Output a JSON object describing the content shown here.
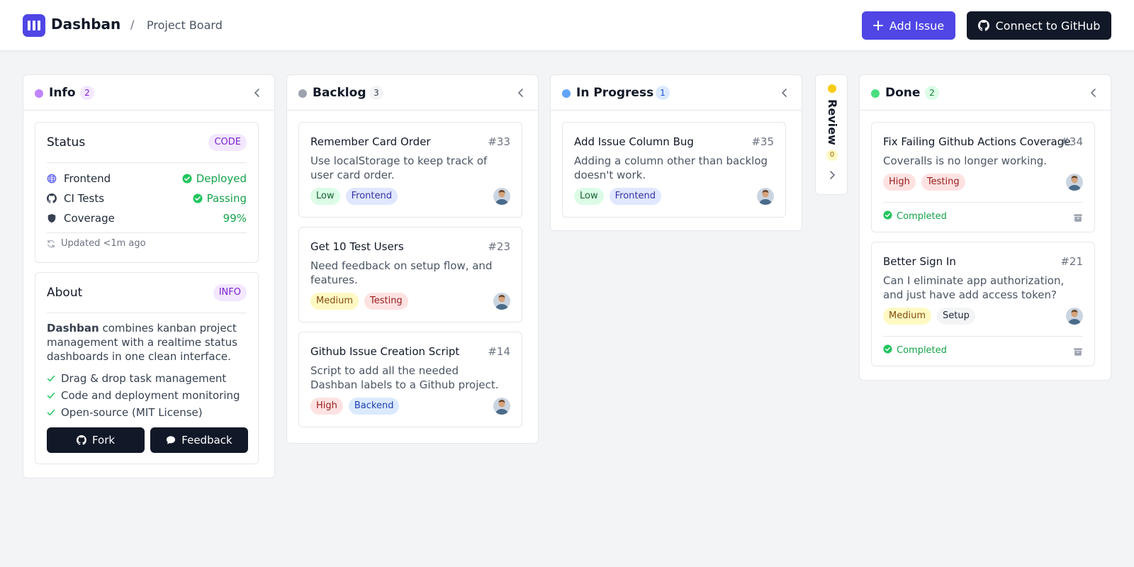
{
  "header": {
    "brand": "Dashban",
    "separator": "/",
    "breadcrumb": "Project Board",
    "add_issue_label": "Add Issue",
    "connect_label": "Connect to GitHub"
  },
  "columns": {
    "info": {
      "title": "Info",
      "count": "2",
      "color": "#c084fc"
    },
    "backlog": {
      "title": "Backlog",
      "count": "3",
      "color": "#9ca3af"
    },
    "in_progress": {
      "title": "In Progress",
      "count": "1",
      "color": "#60a5fa"
    },
    "review": {
      "title": "Review",
      "count": "0",
      "color": "#facc15"
    },
    "done": {
      "title": "Done",
      "count": "2",
      "color": "#4ade80"
    }
  },
  "status_panel": {
    "title": "Status",
    "badge": "CODE",
    "rows": [
      {
        "label": "Frontend",
        "value": "Deployed",
        "icon": "globe-icon"
      },
      {
        "label": "CI Tests",
        "value": "Passing",
        "icon": "github-icon"
      },
      {
        "label": "Coverage",
        "value": "99%",
        "icon": "shield-icon"
      }
    ],
    "updated": "Updated <1m ago"
  },
  "about_panel": {
    "title": "About",
    "badge": "INFO",
    "brand": "Dashban",
    "text": " combines kanban project management with a realtime status dashboards in one clean interface.",
    "features": [
      "Drag & drop task management",
      "Code and deployment monitoring",
      "Open-source (MIT License)"
    ],
    "fork_label": "Fork",
    "feedback_label": "Feedback"
  },
  "backlog_cards": [
    {
      "title": "Remember Card Order",
      "number": "#33",
      "description": "Use localStorage to keep track of user card order.",
      "tags": [
        "Low",
        "Frontend"
      ]
    },
    {
      "title": "Get 10 Test Users",
      "number": "#23",
      "description": "Need feedback on setup flow, and features.",
      "tags": [
        "Medium",
        "Testing"
      ]
    },
    {
      "title": "Github Issue Creation Script",
      "number": "#14",
      "description": "Script to add all the needed Dashban labels to a Github project.",
      "tags": [
        "High",
        "Backend"
      ]
    }
  ],
  "in_progress_cards": [
    {
      "title": "Add Issue Column Bug",
      "number": "#35",
      "description": "Adding a column other than backlog doesn't work.",
      "tags": [
        "Low",
        "Frontend"
      ]
    }
  ],
  "done_cards": [
    {
      "title": "Fix Failing Github Actions Coverage",
      "number": "#34",
      "description": "Coveralls is no longer working.",
      "tags": [
        "High",
        "Testing"
      ],
      "status": "Completed"
    },
    {
      "title": "Better Sign In",
      "number": "#21",
      "description": "Can I eliminate app authorization, and just have add access token?",
      "tags": [
        "Medium",
        "Setup"
      ],
      "status": "Completed"
    }
  ],
  "tag_colors": {
    "Low": {
      "bg": "#dcfce7",
      "fg": "#166534"
    },
    "Medium": {
      "bg": "#fef9c3",
      "fg": "#854d0e"
    },
    "High": {
      "bg": "#fee2e2",
      "fg": "#991b1b"
    },
    "Frontend": {
      "bg": "#e0e7ff",
      "fg": "#3730a3"
    },
    "Backend": {
      "bg": "#dbeafe",
      "fg": "#1e40af"
    },
    "Testing": {
      "bg": "#fee2e2",
      "fg": "#991b1b"
    },
    "Setup": {
      "bg": "#f3f4f6",
      "fg": "#1f2937"
    }
  }
}
